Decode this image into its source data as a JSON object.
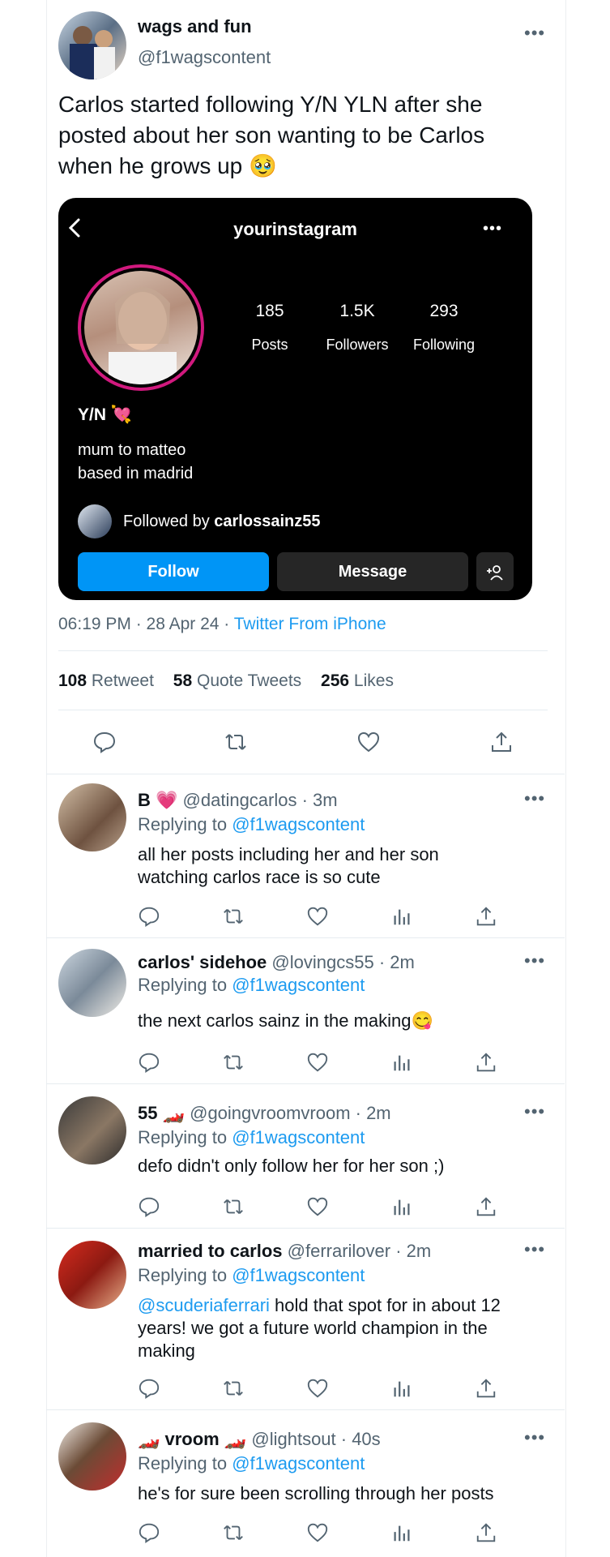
{
  "tweet": {
    "display_name": "wags and fun",
    "handle": "@f1wagscontent",
    "text": "Carlos started following Y/N YLN after she posted about her son wanting to be Carlos when he grows up 🥹",
    "meta_time": "06:19 PM · 28 Apr 24 · ",
    "meta_source": "Twitter From iPhone",
    "stats": {
      "retweets_count": "108",
      "retweets_label": "Retweet",
      "quotes_count": "58",
      "quotes_label": "Quote Tweets",
      "likes_count": "256",
      "likes_label": "Likes"
    }
  },
  "instagram": {
    "username": "yourinstagram",
    "posts_count": "185",
    "posts_label": "Posts",
    "followers_count": "1.5K",
    "followers_label": "Followers",
    "following_count": "293",
    "following_label": "Following",
    "name": "Y/N 💘",
    "bio_line1": "mum to matteo",
    "bio_line2": "based in madrid",
    "followed_by_prefix": "Followed by ",
    "followed_by_user": "carlossainz55",
    "follow_label": "Follow",
    "message_label": "Message",
    "follow_btn_color": "#0095f6",
    "message_btn_color": "#262626"
  },
  "replies": [
    {
      "name": "B 💗",
      "handle": "@datingcarlos · 3m",
      "replying_prefix": "Replying to ",
      "replying_to": "@f1wagscontent",
      "text_line1": "all her posts including her and her son",
      "text_line2": "watching carlos race is so cute"
    },
    {
      "name": "carlos' sidehoe",
      "handle": "@lovingcs55 · 2m",
      "replying_prefix": "Replying to ",
      "replying_to": "@f1wagscontent",
      "text_line1": "the next carlos sainz in the making😋"
    },
    {
      "name": "55 🏎️",
      "handle": "@goingvroomvroom · 2m",
      "replying_prefix": "Replying to ",
      "replying_to": "@f1wagscontent",
      "text_line1": "defo didn't only follow her for her son ;)"
    },
    {
      "name": "married to carlos",
      "handle": "@ferrarilover · 2m",
      "replying_prefix": "Replying to ",
      "replying_to": "@f1wagscontent",
      "mention": "@scuderiaferrari",
      "text_line1_rest": " hold that spot for in about 12",
      "text_line2": "years! we got a future world champion in the",
      "text_line3": "making"
    },
    {
      "name": "🏎️ vroom 🏎️",
      "handle": "@lightsout · 40s",
      "replying_prefix": "Replying to ",
      "replying_to": "@f1wagscontent",
      "text_line1": "he's for sure been scrolling through her posts"
    }
  ],
  "colors": {
    "link": "#1d9bf0",
    "text": "#0f1419",
    "muted": "#536471"
  }
}
